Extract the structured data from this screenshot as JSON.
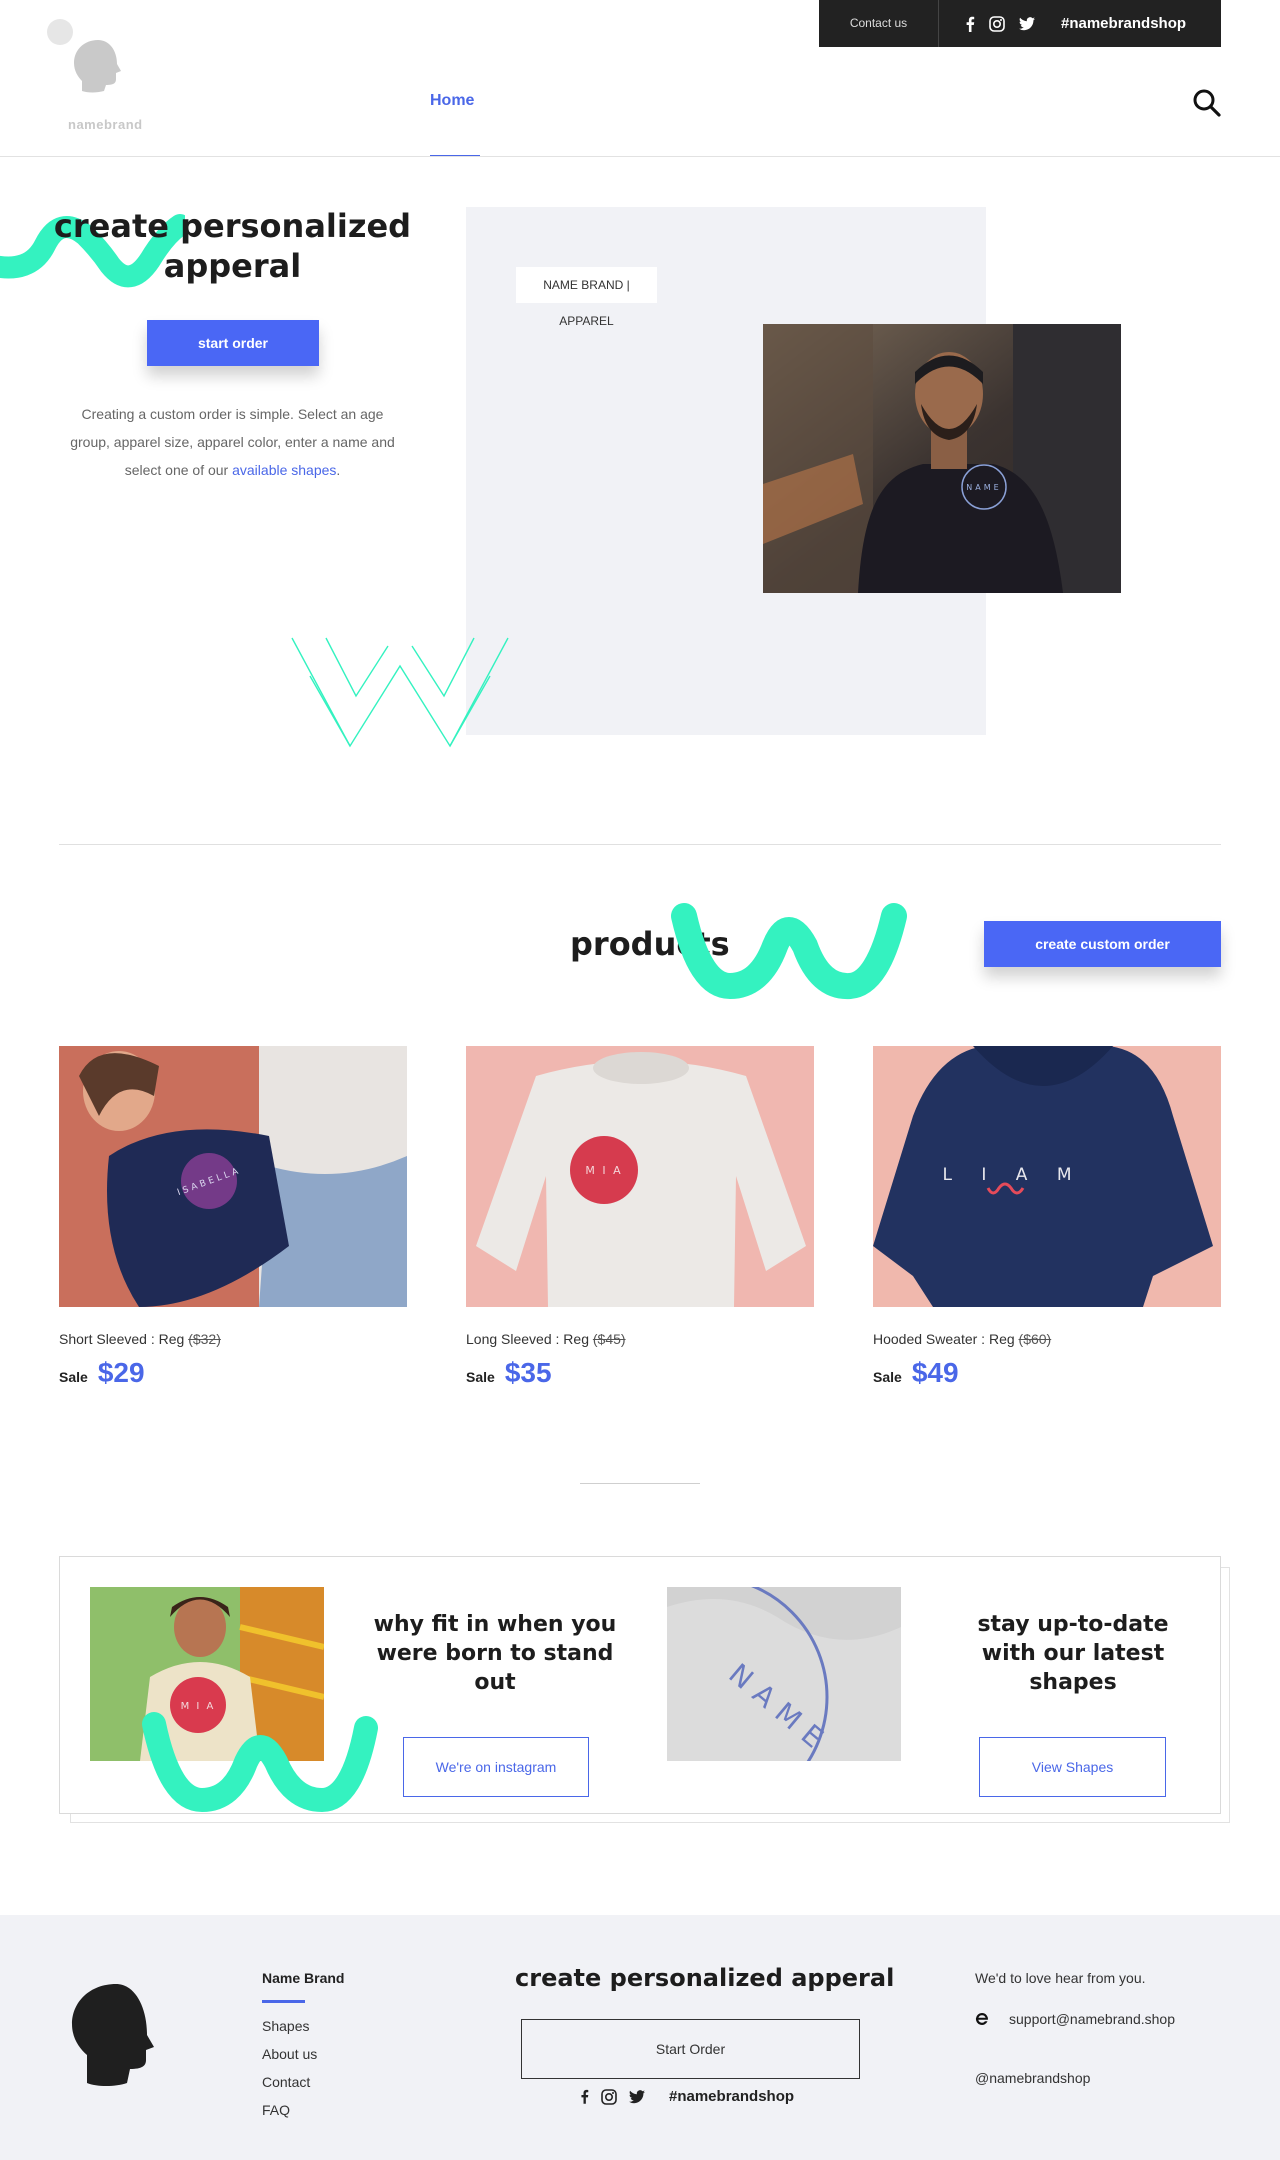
{
  "topbar": {
    "contact_label": "Contact us",
    "social_icons": [
      "facebook-icon",
      "instagram-icon",
      "twitter-icon"
    ],
    "hashtag": "#namebrandshop"
  },
  "header": {
    "logo_text": "namebrand",
    "nav": [
      {
        "label": "Home",
        "active": true
      }
    ],
    "search_icon": "search-icon"
  },
  "hero": {
    "title": "create personalized apperal",
    "cta_label": "start order",
    "description_before": "Creating a custom order is simple. Select an age group, apparel size, apparel color, enter a name and select one of our ",
    "description_link": "available shapes",
    "description_after": ".",
    "brand_tag": "NAME BRAND | APPAREL",
    "shirt_print": "NAME"
  },
  "products_section": {
    "title": "products",
    "cta_label": "create custom order",
    "sale_label": "Sale",
    "items": [
      {
        "name": "Short Sleeved : Reg ",
        "regular_price": "($32)",
        "sale_price": "$29",
        "print": "ISABELLA"
      },
      {
        "name": "Long Sleeved : Reg ",
        "regular_price": "($45)",
        "sale_price": "$35",
        "print": "M I A"
      },
      {
        "name": "Hooded Sweater : Reg ",
        "regular_price": "($60)",
        "sale_price": "$49",
        "print": "L I A M"
      }
    ]
  },
  "promo": {
    "left_title": "why fit in when you were born to stand out",
    "left_button": "We're on instagram",
    "left_img_print": "M I A",
    "right_title": "stay up-to-date with our latest shapes",
    "right_button": "View Shapes",
    "right_img_print": "NAME"
  },
  "footer": {
    "brand": "Name Brand",
    "links": [
      "Shapes",
      "About us",
      "Contact",
      "FAQ"
    ],
    "title": "create personalized apperal",
    "start_label": "Start Order",
    "hashtag": "#namebrandshop",
    "love_text": "We'd to love hear from you.",
    "email": "support@namebrand.shop",
    "handle": "@namebrandshop"
  },
  "colors": {
    "accent": "#4a67e8",
    "button": "#4a67f5",
    "mint": "#34f2c0",
    "dark": "#222222",
    "panel": "#f1f2f6"
  }
}
